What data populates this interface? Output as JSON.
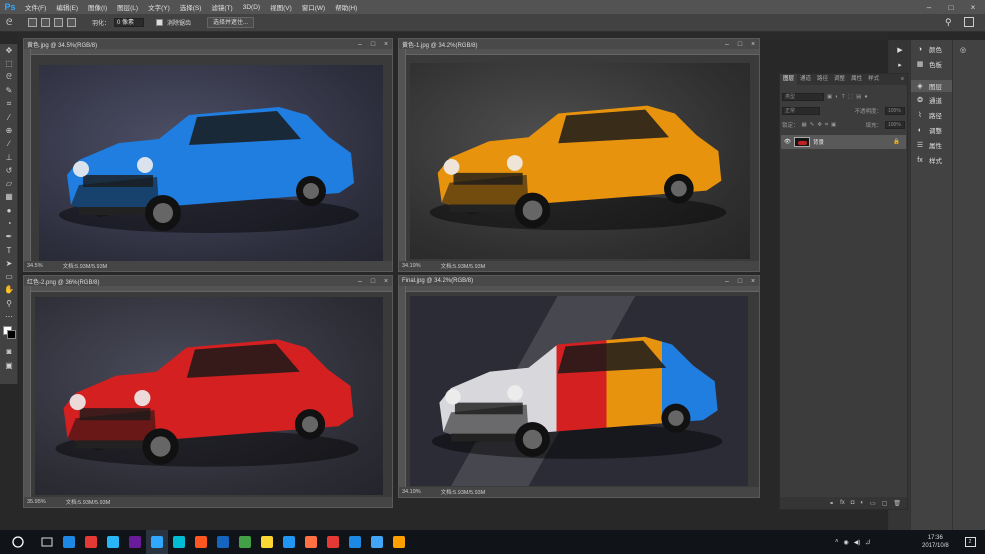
{
  "app": {
    "logo": "Ps"
  },
  "menu": [
    "文件(F)",
    "编辑(E)",
    "图像(I)",
    "图层(L)",
    "文字(Y)",
    "选择(S)",
    "滤镜(T)",
    "3D(D)",
    "视图(V)",
    "窗口(W)",
    "帮助(H)"
  ],
  "window_controls": {
    "minimize": "–",
    "maximize": "□",
    "close": "×"
  },
  "options": {
    "feather_label": "羽化：",
    "feather_value": "0 像素",
    "antialias_label": "消除锯齿",
    "select_mask_button": "选择并遮住..."
  },
  "documents": [
    {
      "title": "黄色.jpg @ 34.5%(RGB/8)",
      "zoom": "34.5%",
      "doc_info": "文档:5.93M/5.93M",
      "car_color": "#1f7ee0"
    },
    {
      "title": "黄色-1.jpg @ 34.2%(RGB/8)",
      "zoom": "34.19%",
      "doc_info": "文档:5.93M/5.93M",
      "car_color": "#e8930e"
    },
    {
      "title": "红色-2.png @ 36%(RGB/8)",
      "zoom": "35.95%",
      "doc_info": "文档:5.93M/5.93M",
      "car_color": "#d42020"
    },
    {
      "title": "Final.jpg @ 34.2%(RGB/8)",
      "zoom": "34.19%",
      "doc_info": "文档:5.93M/5.93M",
      "car_color": "final"
    }
  ],
  "right_panels": {
    "strip1": [
      {
        "icon": "color-icon",
        "label": "颜色"
      },
      {
        "icon": "swatches-icon",
        "label": "色板"
      }
    ],
    "strip2": [
      {
        "icon": "layers-icon",
        "label": "图层"
      },
      {
        "icon": "channels-icon",
        "label": "通道"
      },
      {
        "icon": "paths-icon",
        "label": "路径"
      },
      {
        "icon": "adjustments-icon",
        "label": "调整"
      },
      {
        "icon": "properties-icon",
        "label": "属性"
      },
      {
        "icon": "styles-icon",
        "label": "样式"
      }
    ]
  },
  "layers_panel": {
    "tabs": [
      "图层",
      "通道",
      "路径",
      "调整",
      "属性",
      "样式"
    ],
    "filter_label": "类型",
    "blend_mode": "正常",
    "opacity_label": "不透明度：",
    "opacity_value": "100%",
    "lock_label": "锁定：",
    "fill_label": "填充：",
    "fill_value": "100%",
    "layer_name": "背景"
  },
  "taskbar": {
    "apps": [
      "#1e88e5",
      "#e53935",
      "#29b6f6",
      "#6a1b9a",
      "#31a8ff",
      "#00bcd4",
      "#ff5722",
      "#1565c0",
      "#43a047",
      "#fdd835",
      "#2196f3",
      "#ff7043",
      "#e53935",
      "#1e88e5",
      "#42a5f5",
      "#ffa000"
    ],
    "time": "17:36",
    "date": "2017/10/8",
    "notification_count": "2"
  }
}
